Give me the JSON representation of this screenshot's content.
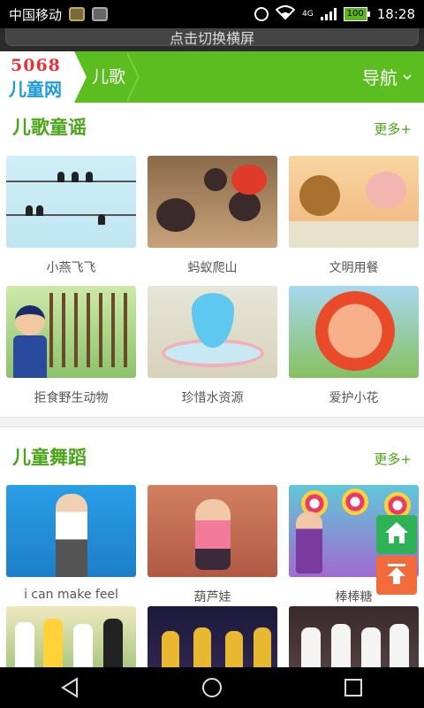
{
  "status_bar": {
    "carrier": "中国移动",
    "network": "4G",
    "battery": "100",
    "time": "18:28"
  },
  "rotate_banner": {
    "text": "点击切换横屏"
  },
  "header": {
    "logo_number": "5068",
    "logo_text": "儿童网",
    "breadcrumb": "儿歌",
    "nav_label": "导航"
  },
  "sections": [
    {
      "title": "儿歌童谣",
      "more": "更多+",
      "items": [
        {
          "label": "小燕飞飞"
        },
        {
          "label": "蚂蚁爬山"
        },
        {
          "label": "文明用餐"
        },
        {
          "label": "拒食野生动物"
        },
        {
          "label": "珍惜水资源"
        },
        {
          "label": "爱护小花"
        }
      ]
    },
    {
      "title": "儿童舞蹈",
      "more": "更多+",
      "items": [
        {
          "label": "i can make feel"
        },
        {
          "label": "葫芦娃"
        },
        {
          "label": "棒棒糖"
        }
      ]
    }
  ],
  "colors": {
    "brand_green": "#5bbd20",
    "title_green": "#4ca41a",
    "home_button": "#2db256",
    "top_button": "#f26b3a"
  },
  "icons": {
    "home": "home-icon",
    "scroll_top": "arrow-up-icon",
    "chevron": "chevron-down-icon"
  }
}
